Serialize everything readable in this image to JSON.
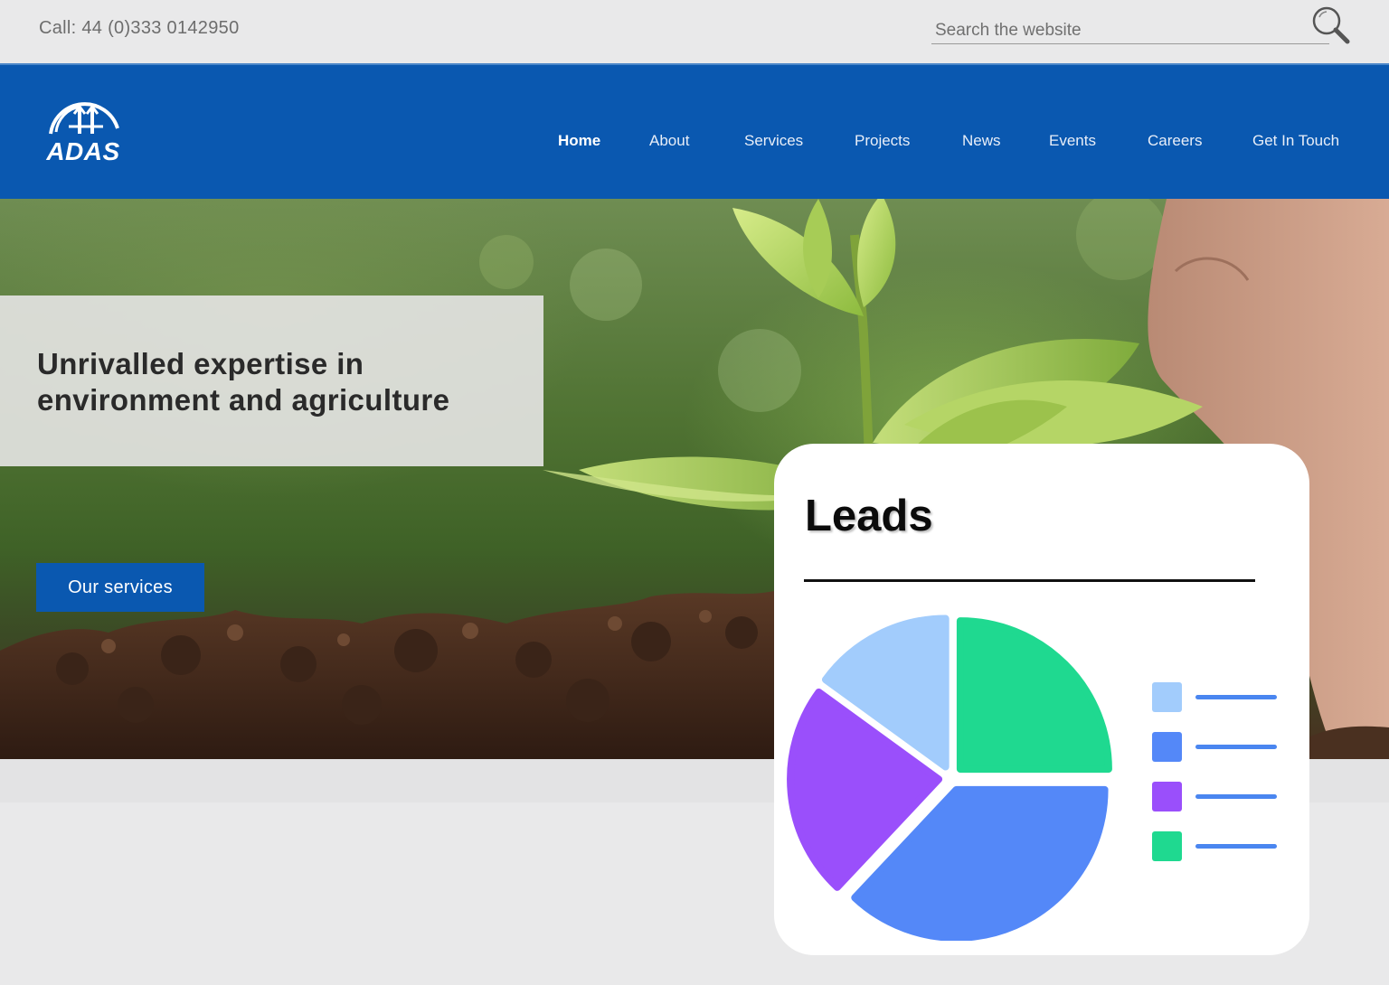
{
  "topbar": {
    "phone": "Call: 44 (0)333 0142950",
    "search_placeholder": "Search the website",
    "search_icon": "search-icon"
  },
  "header": {
    "logo_text": "ADAS",
    "nav": [
      {
        "label": "Home",
        "active": true
      },
      {
        "label": "About"
      },
      {
        "label": "Services"
      },
      {
        "label": "Projects"
      },
      {
        "label": "News"
      },
      {
        "label": "Events"
      },
      {
        "label": "Careers"
      },
      {
        "label": "Get In Touch"
      }
    ]
  },
  "hero": {
    "title_line1": "Unrivalled expertise in",
    "title_line2": "environment and agriculture",
    "cta_label": "Our services"
  },
  "card": {
    "title": "Leads",
    "chart_data": {
      "type": "pie",
      "title": "Leads",
      "slices": [
        {
          "color": "#1fd990",
          "value": 25
        },
        {
          "color": "#5488f8",
          "value": 37
        },
        {
          "color": "#9a4ffb",
          "value": 23
        },
        {
          "color": "#a2ccfc",
          "value": 15
        }
      ],
      "legend_colors": [
        "#a2ccfc",
        "#5488f8",
        "#9a4ffb",
        "#1fd990"
      ],
      "legend_placement": "right"
    }
  },
  "colors": {
    "brand_blue": "#0a58b0",
    "page_bg": "#e9e9ea"
  }
}
